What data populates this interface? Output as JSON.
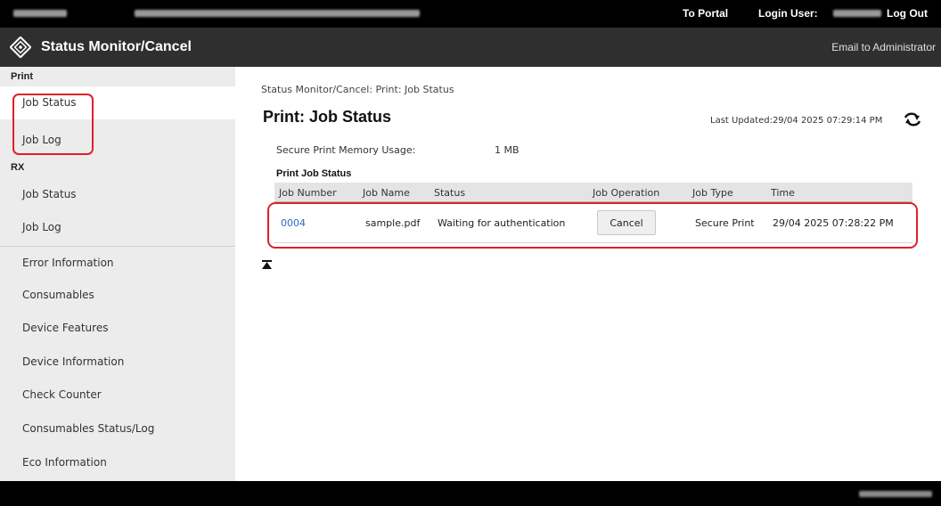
{
  "topbar": {
    "portal_link": "To Portal",
    "login_user_label": "Login User:",
    "logout_link": "Log Out"
  },
  "header": {
    "app_title": "Status Monitor/Cancel",
    "admin_link": "Email to Administrator"
  },
  "sidebar": {
    "sections": [
      "Print",
      "RX"
    ],
    "print_items": [
      "Job Status",
      "Job Log"
    ],
    "rx_items": [
      "Job Status",
      "Job Log"
    ],
    "other_items": [
      "Error Information",
      "Consumables",
      "Device Features",
      "Device Information",
      "Check Counter",
      "Consumables Status/Log",
      "Eco Information"
    ],
    "active": "Job Status"
  },
  "main": {
    "breadcrumb": "Status Monitor/Cancel: Print: Job Status",
    "title": "Print: Job Status",
    "last_updated": "Last Updated:29/04 2025 07:29:14 PM",
    "memory_label": "Secure Print Memory Usage:",
    "memory_value": "1 MB",
    "section_title": "Print Job Status",
    "columns": [
      "Job Number",
      "Job Name",
      "Status",
      "Job Operation",
      "Job Type",
      "Time"
    ],
    "rows": [
      {
        "job_number": "0004",
        "job_name": "sample.pdf",
        "status": "Waiting for authentication",
        "operation": "Cancel",
        "job_type": "Secure Print",
        "time": "29/04 2025 07:28:22 PM"
      }
    ]
  },
  "colors": {
    "topbar": "#000000",
    "titlebar": "#2f2f2f",
    "sidebar": "#ececec",
    "highlight": "#e0202a",
    "link": "#2a6ebb"
  },
  "icons": [
    "logo-icon",
    "refresh-icon",
    "back-to-top-icon"
  ]
}
